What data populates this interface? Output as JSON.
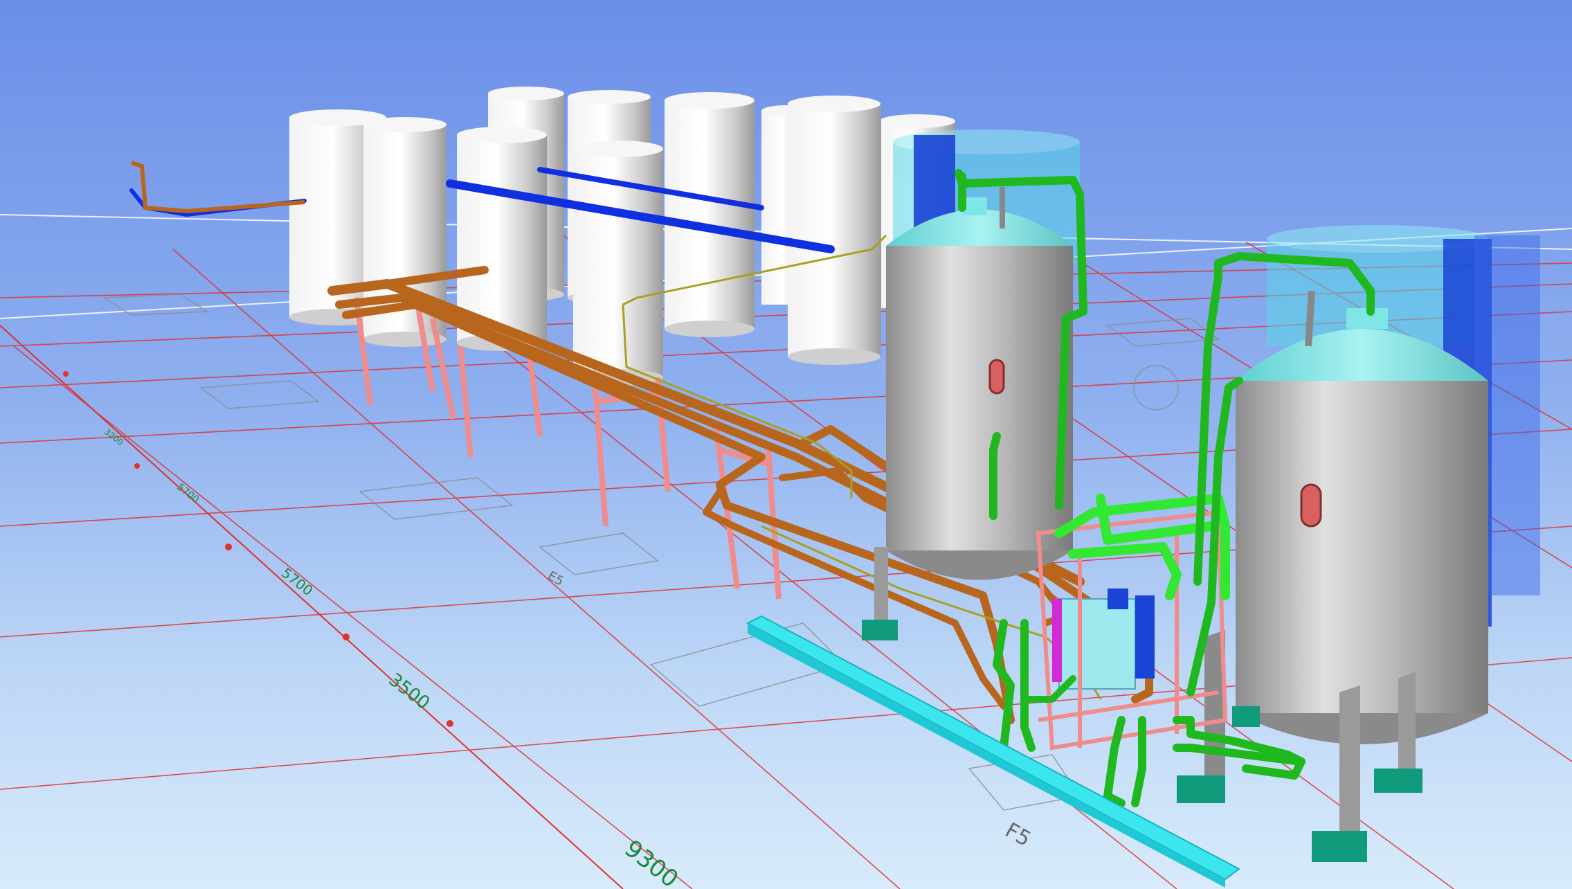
{
  "viewport": {
    "background_top": "#6a8ee8",
    "background_bottom": "#d8ebfb"
  },
  "colors": {
    "grid_line": "#e03030",
    "copper_pipe": "#b8661e",
    "green_pipe": "#1fb81f",
    "blue_pipe": "#1030e0",
    "support_frame": "#f08c8c",
    "cyan_base": "#3ce6ee",
    "vessel_grey": "#b4b4b4",
    "vessel_top": "#7fe6e6",
    "foot_pad": "#0f9b7c"
  },
  "dimensions": {
    "d1": "3500",
    "d2": "9300",
    "d3": "5700",
    "d4": "5700",
    "d5": "3200"
  },
  "grid_labels": {
    "f5_near": "F5",
    "f5_mid": "E5"
  }
}
